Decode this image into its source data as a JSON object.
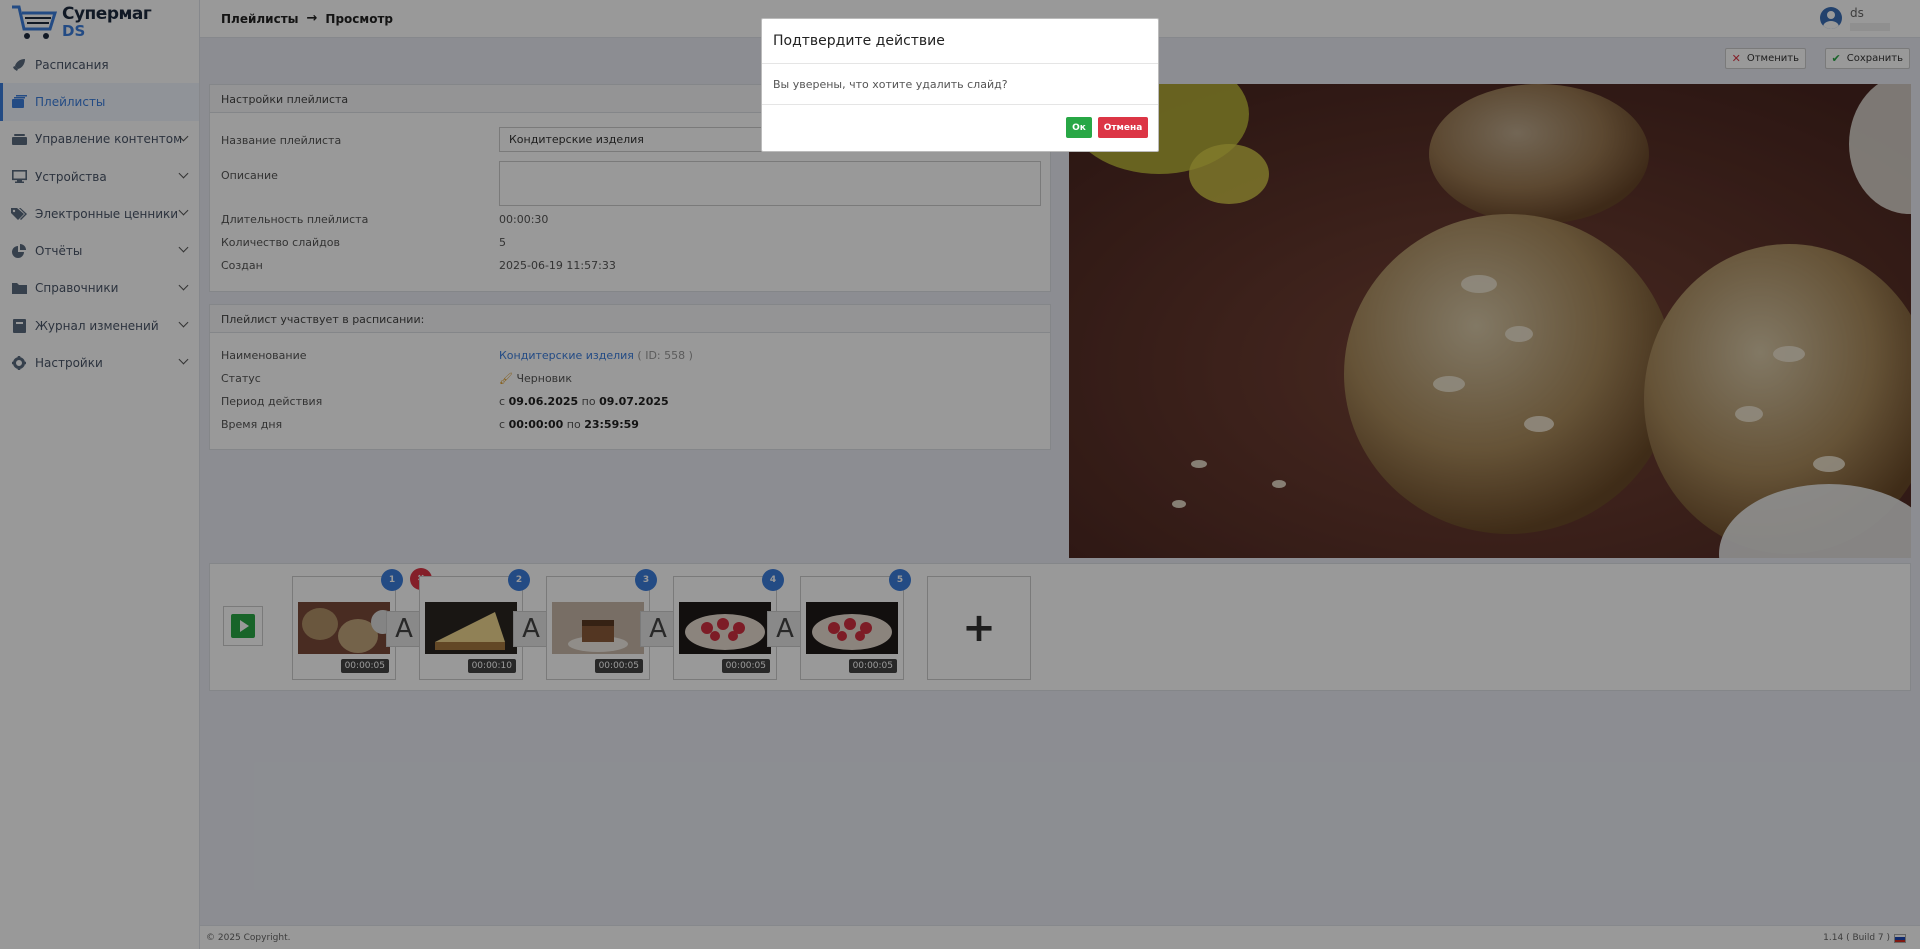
{
  "logo": {
    "line1": "Супермаг",
    "line2": "DS"
  },
  "nav": [
    {
      "label": "Расписания",
      "icon": "rocket-icon",
      "chevron": false,
      "active": false
    },
    {
      "label": "Плейлисты",
      "icon": "playlist-icon",
      "chevron": false,
      "active": true
    },
    {
      "label": "Управление контентом",
      "icon": "content-icon",
      "chevron": true,
      "active": false
    },
    {
      "label": "Устройства",
      "icon": "monitor-icon",
      "chevron": true,
      "active": false
    },
    {
      "label": "Электронные ценники",
      "icon": "tags-icon",
      "chevron": true,
      "active": false
    },
    {
      "label": "Отчёты",
      "icon": "pie-chart-icon",
      "chevron": true,
      "active": false
    },
    {
      "label": "Справочники",
      "icon": "folder-icon",
      "chevron": true,
      "active": false
    },
    {
      "label": "Журнал изменений",
      "icon": "journal-icon",
      "chevron": true,
      "active": false
    },
    {
      "label": "Настройки",
      "icon": "gear-icon",
      "chevron": true,
      "active": false
    }
  ],
  "breadcrumb": {
    "section": "Плейлисты",
    "page": "Просмотр"
  },
  "user": {
    "name": "ds"
  },
  "actions": {
    "cancel": "Отменить",
    "save": "Сохранить"
  },
  "settings": {
    "header": "Настройки плейлиста",
    "name_label": "Название плейлиста",
    "name_value": "Кондитерские изделия",
    "desc_label": "Описание",
    "desc_value": "",
    "duration_label": "Длительность плейлиста",
    "duration_value": "00:00:30",
    "count_label": "Количество слайдов",
    "count_value": "5",
    "created_label": "Создан",
    "created_value": "2025-06-19 11:57:33"
  },
  "schedule": {
    "header": "Плейлист участвует в расписании:",
    "name_label": "Наименование",
    "name_link": "Кондитерские изделия",
    "name_id": "( ID: 558 )",
    "status_label": "Статус",
    "status_value": "Черновик",
    "period_label": "Период действия",
    "period_from_word": "с",
    "period_from": "09.06.2025",
    "period_to_word": "по",
    "period_to": "09.07.2025",
    "time_label": "Время дня",
    "time_from_word": "с",
    "time_from": "00:00:00",
    "time_to_word": "по",
    "time_to": "23:59:59"
  },
  "slides": [
    {
      "num": "1",
      "duration": "00:00:05",
      "image": "cookies-thumbnail"
    },
    {
      "num": "2",
      "duration": "00:00:10",
      "image": "cheesecake-thumbnail"
    },
    {
      "num": "3",
      "duration": "00:00:05",
      "image": "dessert-thumbnail"
    },
    {
      "num": "4",
      "duration": "00:00:05",
      "image": "strawberry-tart-thumbnail"
    },
    {
      "num": "5",
      "duration": "00:00:05",
      "image": "strawberry-tart-thumbnail"
    }
  ],
  "transition_label": "A",
  "add_label": "+",
  "footer": {
    "copyright": "© 2025 Copyright.",
    "version": "1.14 ( Build 7 )"
  },
  "modal": {
    "title": "Подтвердите действие",
    "message": "Вы уверены, что хотите удалить слайд?",
    "ok": "Ок",
    "cancel": "Отмена"
  },
  "colors": {
    "accent": "#3b7ddd",
    "ok": "#28a745",
    "danger": "#dc3545"
  }
}
